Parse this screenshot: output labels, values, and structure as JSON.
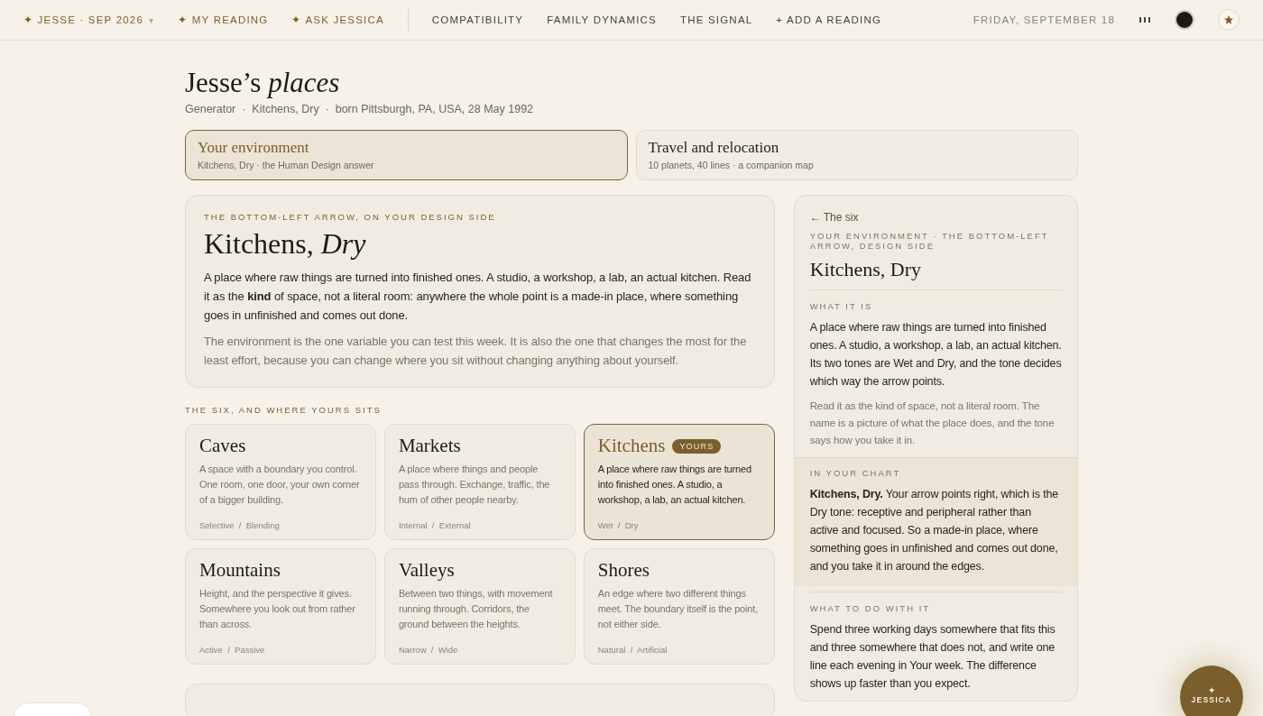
{
  "nav": {
    "brand": "✦ JESSE · SEP 2026",
    "brand_caret": "▾",
    "primary": [
      {
        "label": "✦ MY READING"
      },
      {
        "label": "✦ ASK JESSICA"
      }
    ],
    "links": [
      {
        "label": "COMPATIBILITY"
      },
      {
        "label": "FAMILY DYNAMICS"
      },
      {
        "label": "THE SIGNAL"
      },
      {
        "label": "+ ADD A READING"
      }
    ],
    "date": "FRIDAY, SEPTEMBER 18"
  },
  "header": {
    "title": "Jesse’s *places*",
    "subtitle": "Generator  ·  Kitchens, Dry  ·  born Pittsburgh, PA, USA, 28 May 1992"
  },
  "tabs": [
    {
      "title": "Your environment",
      "caption": "Kitchens, Dry · the Human Design answer",
      "selected": true
    },
    {
      "title": "Travel and relocation",
      "caption": "10 planets, 40 lines · a companion map",
      "selected": false
    }
  ],
  "feature": {
    "eyebrow": "THE BOTTOM-LEFT ARROW, ON YOUR DESIGN SIDE",
    "title": "Kitchens, *Dry*",
    "body": "A place where raw things are turned into finished ones. A studio, a workshop, a lab, an actual kitchen. Read it as the **kind** of space, not a literal room: anywhere the whole point is a made-in place, where something goes in unfinished and comes out done.",
    "note": "The environment is the one variable you can test this week. It is also the one that changes the most for the least effort, because you can change where you sit without changing anything about yourself."
  },
  "six": {
    "label": "THE SIX, AND WHERE YOURS SITS",
    "places": [
      {
        "name": "Caves",
        "text": "A space with a boundary you control. One room, one door, your own corner of a bigger building.",
        "poles": "Selective  /  Blending",
        "selected": false
      },
      {
        "name": "Markets",
        "text": "A place where things and people pass through. Exchange, traffic, the hum of other people nearby.",
        "poles": "Internal  /  External",
        "selected": false
      },
      {
        "name": "Kitchens",
        "badge": "YOURS",
        "text": "A place where raw things are turned into finished ones. A studio, a workshop, a lab, an actual kitchen.",
        "poles": "Wet  /  Dry",
        "selected": true
      },
      {
        "name": "Mountains",
        "text": "Height, and the perspective it gives. Somewhere you look out from rather than across.",
        "poles": "Active  /  Passive",
        "selected": false
      },
      {
        "name": "Valleys",
        "text": "Between two things, with movement running through. Corridors, the ground between the heights.",
        "poles": "Narrow  /  Wide",
        "selected": false
      },
      {
        "name": "Shores",
        "text": "An edge where two different things meet. The boundary itself is the point, not either side.",
        "poles": "Natural  /  Artificial",
        "selected": false
      }
    ]
  },
  "panel": {
    "back": "← The six",
    "eyebrow": "YOUR ENVIRONMENT · THE BOTTOM-LEFT ARROW, DESIGN SIDE",
    "title": "Kitchens, Dry",
    "sections": [
      {
        "label": "WHAT IT IS",
        "highlighted": false,
        "body": "A place where raw things are turned into finished ones. A studio, a workshop, a lab, an actual kitchen. Its two tones are Wet and Dry, and the tone decides which way the arrow points.",
        "note": "Read it as the kind of space, not a literal room. The name is a picture of what the place does, and the tone says how you take it in."
      },
      {
        "label": "IN YOUR CHART",
        "highlighted": true,
        "body": "**Kitchens, Dry.** Your arrow points right, which is the Dry tone: receptive and peripheral rather than active and focused. So a made-in place, where something goes in unfinished and comes out done, and you take it in around the edges."
      },
      {
        "label": "WHAT TO DO WITH IT",
        "highlighted": false,
        "body": "Spend three working days somewhere that fits this and three somewhere that does not, and write one line each evening in Your week. The difference shows up faster than you expect."
      }
    ]
  },
  "assistant": {
    "icon": "✦",
    "label": "JESSICA"
  }
}
